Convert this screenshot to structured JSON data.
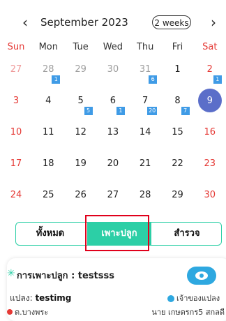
{
  "header": {
    "prev_icon": "‹",
    "next_icon": "›",
    "title": "September 2023",
    "view_toggle": "2 weeks"
  },
  "calendar": {
    "dow": [
      "Sun",
      "Mon",
      "Tue",
      "Wed",
      "Thu",
      "Fri",
      "Sat"
    ],
    "weeks": [
      [
        {
          "d": "27",
          "o": true
        },
        {
          "d": "28",
          "o": true,
          "b": "1"
        },
        {
          "d": "29",
          "o": true
        },
        {
          "d": "30",
          "o": true
        },
        {
          "d": "31",
          "o": true,
          "b": "6"
        },
        {
          "d": "1"
        },
        {
          "d": "2",
          "b": "1"
        }
      ],
      [
        {
          "d": "3"
        },
        {
          "d": "4"
        },
        {
          "d": "5",
          "b": "5"
        },
        {
          "d": "6",
          "b": "1"
        },
        {
          "d": "7",
          "b": "20"
        },
        {
          "d": "8",
          "b": "7"
        },
        {
          "d": "9",
          "today": true
        }
      ],
      [
        {
          "d": "10"
        },
        {
          "d": "11"
        },
        {
          "d": "12"
        },
        {
          "d": "13"
        },
        {
          "d": "14"
        },
        {
          "d": "15"
        },
        {
          "d": "16"
        }
      ],
      [
        {
          "d": "17"
        },
        {
          "d": "18"
        },
        {
          "d": "19"
        },
        {
          "d": "20"
        },
        {
          "d": "21"
        },
        {
          "d": "22"
        },
        {
          "d": "23"
        }
      ],
      [
        {
          "d": "24"
        },
        {
          "d": "25"
        },
        {
          "d": "26"
        },
        {
          "d": "27"
        },
        {
          "d": "28"
        },
        {
          "d": "29"
        },
        {
          "d": "30"
        }
      ]
    ]
  },
  "filter": {
    "all": "ทั้งหมด",
    "planting": "เพาะปลูก",
    "survey": "สำรวจ"
  },
  "card": {
    "title": "การเพาะปลูก : testsss",
    "plot_label": "แปลง:",
    "plot_value": "testimg",
    "owner": "เจ้าของแปลง",
    "location": "ต.บางพระ",
    "person": "นาย เกษตรกร5 สกลดี"
  },
  "colors": {
    "accent": "#2ccfa6",
    "today": "#5b6ec9",
    "badge": "#3f9be6",
    "weekend": "#e53935"
  }
}
